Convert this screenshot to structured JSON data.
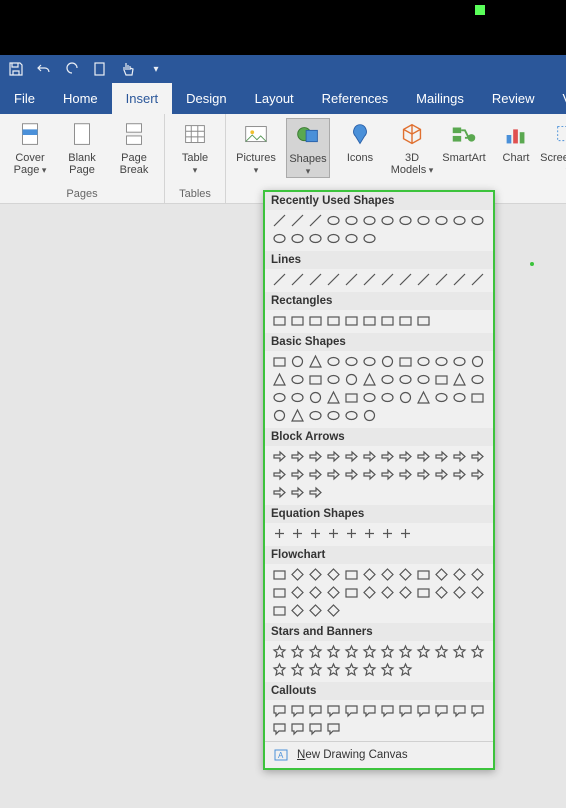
{
  "qat": {
    "save": "Save",
    "undo": "Undo",
    "redo": "Redo",
    "new": "New",
    "touch": "Touch/Mouse Mode"
  },
  "tabs": [
    "File",
    "Home",
    "Insert",
    "Design",
    "Layout",
    "References",
    "Mailings",
    "Review",
    "View"
  ],
  "active_tab": "Insert",
  "ribbon": {
    "pages": {
      "label": "Pages",
      "cover": "Cover Page",
      "blank": "Blank Page",
      "break": "Page Break"
    },
    "tables": {
      "label": "Tables",
      "table": "Table"
    },
    "illustrations": {
      "pictures": "Pictures",
      "shapes": "Shapes",
      "icons": "Icons",
      "models": "3D Models",
      "smartart": "SmartArt",
      "chart": "Chart",
      "screenshot": "Screenshot"
    }
  },
  "shapes_panel": {
    "recently_used": "Recently Used Shapes",
    "lines": "Lines",
    "rectangles": "Rectangles",
    "basic": "Basic Shapes",
    "block_arrows": "Block Arrows",
    "equation": "Equation Shapes",
    "flowchart": "Flowchart",
    "stars": "Stars and Banners",
    "callouts": "Callouts",
    "new_canvas": "New Drawing Canvas",
    "counts": {
      "recently_used": 18,
      "lines": 12,
      "rectangles": 9,
      "basic": 42,
      "block_arrows": 27,
      "equation": 8,
      "flowchart": 28,
      "stars": 20,
      "callouts": 16
    }
  }
}
